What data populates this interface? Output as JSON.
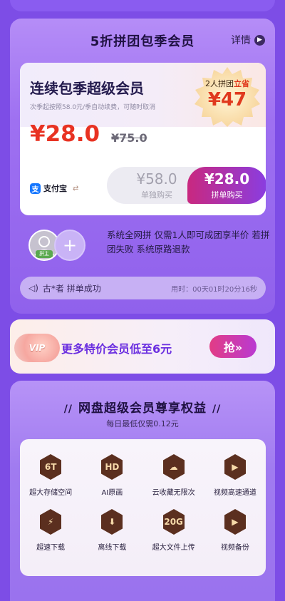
{
  "group": {
    "title": "5折拼团包季会员",
    "detail_label": "详情",
    "offer": {
      "heading": "连续包季超级会员",
      "subtext": "次季起按照58.0元/季自动续费，可随时取消",
      "badge_prefix": "2人拼团",
      "badge_highlight": "立省",
      "badge_price": "¥47",
      "price": "¥28.0",
      "old_price": "¥75.0",
      "pay_method": "支付宝",
      "single_price": "¥58.0",
      "single_label": "单独购买",
      "group_price": "¥28.0",
      "group_label": "拼单购买"
    },
    "owner_tag": "拼主",
    "rule_text": "系统全网拼 仅需1人即可成团享半价 若拼团失败 系统原路退款",
    "ticker": {
      "name": "古*者  拼单成功",
      "time": "用时：00天01时20分16秒"
    }
  },
  "promo": {
    "badge": "VIP",
    "text": "更多特价会员低至6元",
    "button": "抢»"
  },
  "benefits": {
    "title": "网盘超级会员尊享权益",
    "subtitle": "每日最低仅需0.12元",
    "items": [
      {
        "glyph": "6T",
        "icon": "storage-icon",
        "label": "超大存储空间"
      },
      {
        "glyph": "HD",
        "icon": "hd-icon",
        "label": "AI原画"
      },
      {
        "glyph": "☁",
        "icon": "cloud-save-icon",
        "label": "云收藏无限次"
      },
      {
        "glyph": "▶",
        "icon": "video-speed-icon",
        "label": "视频高速通道"
      },
      {
        "glyph": "⚡",
        "icon": "lightning-icon",
        "label": "超速下载"
      },
      {
        "glyph": "⬇",
        "icon": "offline-download-icon",
        "label": "离线下载"
      },
      {
        "glyph": "20G",
        "icon": "large-file-icon",
        "label": "超大文件上传"
      },
      {
        "glyph": "▶",
        "icon": "video-backup-icon",
        "label": "视频备份"
      }
    ]
  },
  "colors": {
    "background": "#7d4de6",
    "price_red": "#e83222",
    "accent_purple": "#6b2fe0"
  }
}
